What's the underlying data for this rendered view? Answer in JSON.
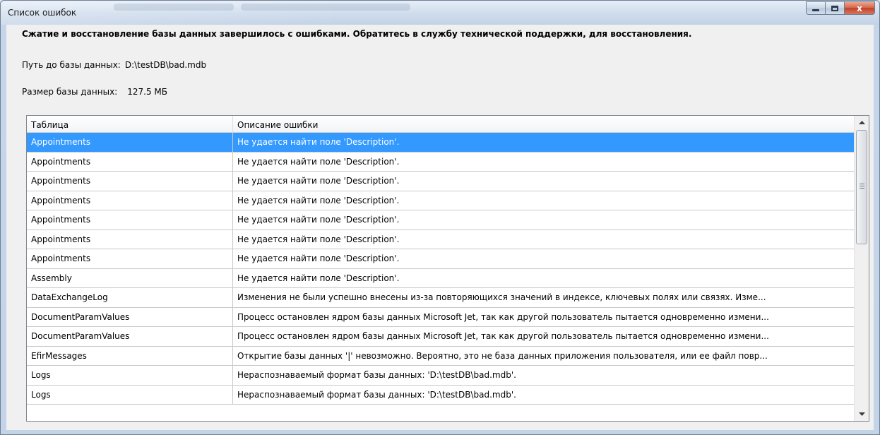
{
  "window": {
    "title": "Список ошибок",
    "close_glyph": "x"
  },
  "content": {
    "headline": "Сжатие и восстановление базы данных завершилось с ошибками. Обратитесь в службу технической поддержки, для восстановления.",
    "db_path_label": "Путь до базы данных:",
    "db_path_value": "D:\\testDB\\bad.mdb",
    "db_size_label": "Размер базы данных:",
    "db_size_value": "127.5 МБ"
  },
  "grid": {
    "columns": [
      "Таблица",
      "Описание ошибки"
    ],
    "rows": [
      {
        "table": "Appointments",
        "error": "Не удается найти поле 'Description'."
      },
      {
        "table": "Appointments",
        "error": "Не удается найти поле 'Description'."
      },
      {
        "table": "Appointments",
        "error": "Не удается найти поле 'Description'."
      },
      {
        "table": "Appointments",
        "error": "Не удается найти поле 'Description'."
      },
      {
        "table": "Appointments",
        "error": "Не удается найти поле 'Description'."
      },
      {
        "table": "Appointments",
        "error": "Не удается найти поле 'Description'."
      },
      {
        "table": "Appointments",
        "error": "Не удается найти поле 'Description'."
      },
      {
        "table": "Assembly",
        "error": "Не удается найти поле 'Description'."
      },
      {
        "table": "DataExchangeLog",
        "error": "Изменения не были успешно внесены из-за повторяющихся значений в индексе, ключевых полях или связях.  Изме..."
      },
      {
        "table": "DocumentParamValues",
        "error": "Процесс остановлен ядром базы данных Microsoft Jet, так как другой пользователь пытается одновременно измени..."
      },
      {
        "table": "DocumentParamValues",
        "error": "Процесс остановлен ядром базы данных Microsoft Jet, так как другой пользователь пытается одновременно измени..."
      },
      {
        "table": "EfirMessages",
        "error": "Открытие базы данных '|' невозможно.  Вероятно, это не база данных приложения пользователя, или ее файл повр..."
      },
      {
        "table": "Logs",
        "error": "Нераспознаваемый формат базы данных: 'D:\\testDB\\bad.mdb'."
      },
      {
        "table": "Logs",
        "error": "Нераспознаваемый формат базы данных: 'D:\\testDB\\bad.mdb'."
      }
    ],
    "selected_index": 0
  },
  "icons": {
    "minimize": "minimize-icon",
    "maximize": "maximize-icon",
    "close": "close-icon",
    "scroll_up": "scroll-up-arrow-icon",
    "scroll_down": "scroll-down-arrow-icon"
  },
  "colors": {
    "selection": "#3399ff",
    "close_button": "#c2412a"
  }
}
